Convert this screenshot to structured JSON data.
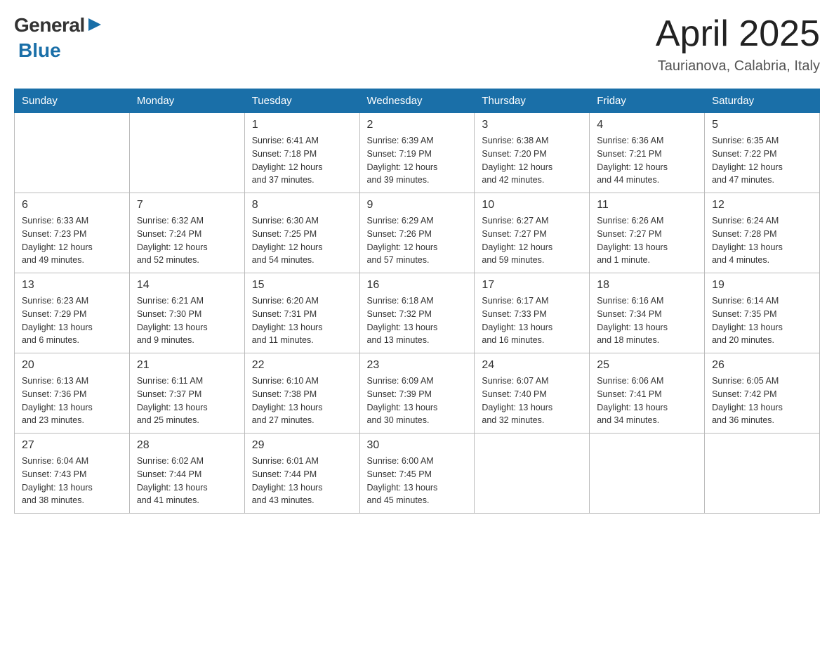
{
  "header": {
    "logo": {
      "general": "General",
      "blue": "Blue"
    },
    "title": "April 2025",
    "location": "Taurianova, Calabria, Italy"
  },
  "calendar": {
    "days_of_week": [
      "Sunday",
      "Monday",
      "Tuesday",
      "Wednesday",
      "Thursday",
      "Friday",
      "Saturday"
    ],
    "weeks": [
      [
        {
          "day": "",
          "info": ""
        },
        {
          "day": "",
          "info": ""
        },
        {
          "day": "1",
          "info": "Sunrise: 6:41 AM\nSunset: 7:18 PM\nDaylight: 12 hours\nand 37 minutes."
        },
        {
          "day": "2",
          "info": "Sunrise: 6:39 AM\nSunset: 7:19 PM\nDaylight: 12 hours\nand 39 minutes."
        },
        {
          "day": "3",
          "info": "Sunrise: 6:38 AM\nSunset: 7:20 PM\nDaylight: 12 hours\nand 42 minutes."
        },
        {
          "day": "4",
          "info": "Sunrise: 6:36 AM\nSunset: 7:21 PM\nDaylight: 12 hours\nand 44 minutes."
        },
        {
          "day": "5",
          "info": "Sunrise: 6:35 AM\nSunset: 7:22 PM\nDaylight: 12 hours\nand 47 minutes."
        }
      ],
      [
        {
          "day": "6",
          "info": "Sunrise: 6:33 AM\nSunset: 7:23 PM\nDaylight: 12 hours\nand 49 minutes."
        },
        {
          "day": "7",
          "info": "Sunrise: 6:32 AM\nSunset: 7:24 PM\nDaylight: 12 hours\nand 52 minutes."
        },
        {
          "day": "8",
          "info": "Sunrise: 6:30 AM\nSunset: 7:25 PM\nDaylight: 12 hours\nand 54 minutes."
        },
        {
          "day": "9",
          "info": "Sunrise: 6:29 AM\nSunset: 7:26 PM\nDaylight: 12 hours\nand 57 minutes."
        },
        {
          "day": "10",
          "info": "Sunrise: 6:27 AM\nSunset: 7:27 PM\nDaylight: 12 hours\nand 59 minutes."
        },
        {
          "day": "11",
          "info": "Sunrise: 6:26 AM\nSunset: 7:27 PM\nDaylight: 13 hours\nand 1 minute."
        },
        {
          "day": "12",
          "info": "Sunrise: 6:24 AM\nSunset: 7:28 PM\nDaylight: 13 hours\nand 4 minutes."
        }
      ],
      [
        {
          "day": "13",
          "info": "Sunrise: 6:23 AM\nSunset: 7:29 PM\nDaylight: 13 hours\nand 6 minutes."
        },
        {
          "day": "14",
          "info": "Sunrise: 6:21 AM\nSunset: 7:30 PM\nDaylight: 13 hours\nand 9 minutes."
        },
        {
          "day": "15",
          "info": "Sunrise: 6:20 AM\nSunset: 7:31 PM\nDaylight: 13 hours\nand 11 minutes."
        },
        {
          "day": "16",
          "info": "Sunrise: 6:18 AM\nSunset: 7:32 PM\nDaylight: 13 hours\nand 13 minutes."
        },
        {
          "day": "17",
          "info": "Sunrise: 6:17 AM\nSunset: 7:33 PM\nDaylight: 13 hours\nand 16 minutes."
        },
        {
          "day": "18",
          "info": "Sunrise: 6:16 AM\nSunset: 7:34 PM\nDaylight: 13 hours\nand 18 minutes."
        },
        {
          "day": "19",
          "info": "Sunrise: 6:14 AM\nSunset: 7:35 PM\nDaylight: 13 hours\nand 20 minutes."
        }
      ],
      [
        {
          "day": "20",
          "info": "Sunrise: 6:13 AM\nSunset: 7:36 PM\nDaylight: 13 hours\nand 23 minutes."
        },
        {
          "day": "21",
          "info": "Sunrise: 6:11 AM\nSunset: 7:37 PM\nDaylight: 13 hours\nand 25 minutes."
        },
        {
          "day": "22",
          "info": "Sunrise: 6:10 AM\nSunset: 7:38 PM\nDaylight: 13 hours\nand 27 minutes."
        },
        {
          "day": "23",
          "info": "Sunrise: 6:09 AM\nSunset: 7:39 PM\nDaylight: 13 hours\nand 30 minutes."
        },
        {
          "day": "24",
          "info": "Sunrise: 6:07 AM\nSunset: 7:40 PM\nDaylight: 13 hours\nand 32 minutes."
        },
        {
          "day": "25",
          "info": "Sunrise: 6:06 AM\nSunset: 7:41 PM\nDaylight: 13 hours\nand 34 minutes."
        },
        {
          "day": "26",
          "info": "Sunrise: 6:05 AM\nSunset: 7:42 PM\nDaylight: 13 hours\nand 36 minutes."
        }
      ],
      [
        {
          "day": "27",
          "info": "Sunrise: 6:04 AM\nSunset: 7:43 PM\nDaylight: 13 hours\nand 38 minutes."
        },
        {
          "day": "28",
          "info": "Sunrise: 6:02 AM\nSunset: 7:44 PM\nDaylight: 13 hours\nand 41 minutes."
        },
        {
          "day": "29",
          "info": "Sunrise: 6:01 AM\nSunset: 7:44 PM\nDaylight: 13 hours\nand 43 minutes."
        },
        {
          "day": "30",
          "info": "Sunrise: 6:00 AM\nSunset: 7:45 PM\nDaylight: 13 hours\nand 45 minutes."
        },
        {
          "day": "",
          "info": ""
        },
        {
          "day": "",
          "info": ""
        },
        {
          "day": "",
          "info": ""
        }
      ]
    ]
  }
}
